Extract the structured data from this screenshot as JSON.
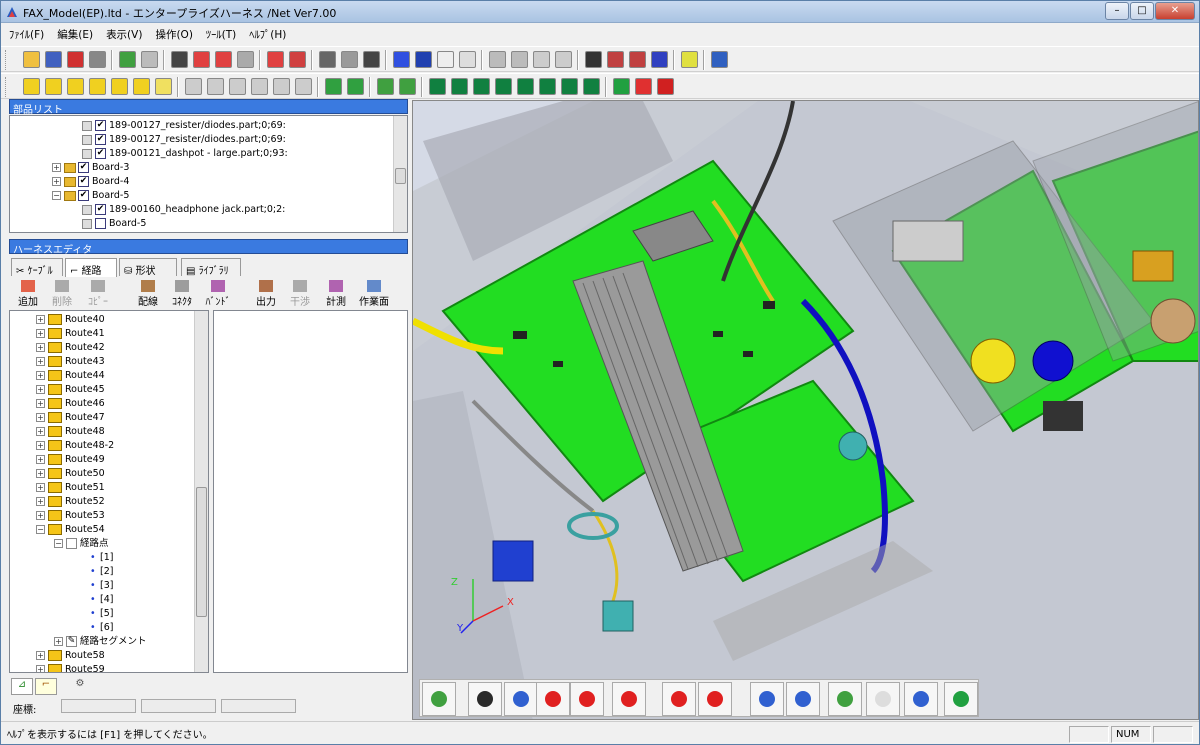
{
  "window": {
    "title": "FAX_Model(EP).ltd - エンタープライズハーネス /Net Ver7.00"
  },
  "menu": [
    "ﾌｧｲﾙ(F)",
    "編集(E)",
    "表示(V)",
    "操作(O)",
    "ﾂｰﾙ(T)",
    "ﾍﾙﾌﾟ(H)"
  ],
  "parts_list": {
    "header": "部品リスト",
    "items": [
      "189-00127_resister/diodes.part;0;69:",
      "189-00127_resister/diodes.part;0;69:",
      "189-00121_dashpot - large.part;0;93:",
      "Board-3",
      "Board-4",
      "Board-5",
      "189-00160_headphone jack.part;0;2:",
      "Board-5"
    ]
  },
  "harness_editor": {
    "header": "ハーネスエディタ",
    "tabs": [
      "ｹｰﾌﾞﾙ",
      "経路",
      "形状",
      "ﾗｲﾌﾞﾗﾘ"
    ],
    "buttons": [
      "追加",
      "削除",
      "ｺﾋﾟｰ",
      "配線",
      "ｺﾈｸﾀ",
      "ﾊﾞﾝﾄﾞ",
      "出力",
      "干渉",
      "計測",
      "作業面"
    ]
  },
  "route_tree": {
    "routes_before": [
      "Route40",
      "Route41",
      "Route42",
      "Route43",
      "Route44",
      "Route45",
      "Route46",
      "Route47",
      "Route48",
      "Route48-2",
      "Route49",
      "Route50",
      "Route51",
      "Route52",
      "Route53",
      "Route54"
    ],
    "route_point": "経路点",
    "points": [
      "[1]",
      "[2]",
      "[3]",
      "[4]",
      "[5]",
      "[6]"
    ],
    "segment": "経路セグメント",
    "routes_after": [
      "Route58",
      "Route59"
    ]
  },
  "coord_label": "座標:",
  "status": {
    "help": "ﾍﾙﾌﾟを表示するには [F1] を押してください。",
    "num": "NUM"
  },
  "axes": {
    "x": "X",
    "y": "Y",
    "z": "Z"
  },
  "colors": {
    "pcb": "#22dd22",
    "accent": "#3a7ae0"
  }
}
